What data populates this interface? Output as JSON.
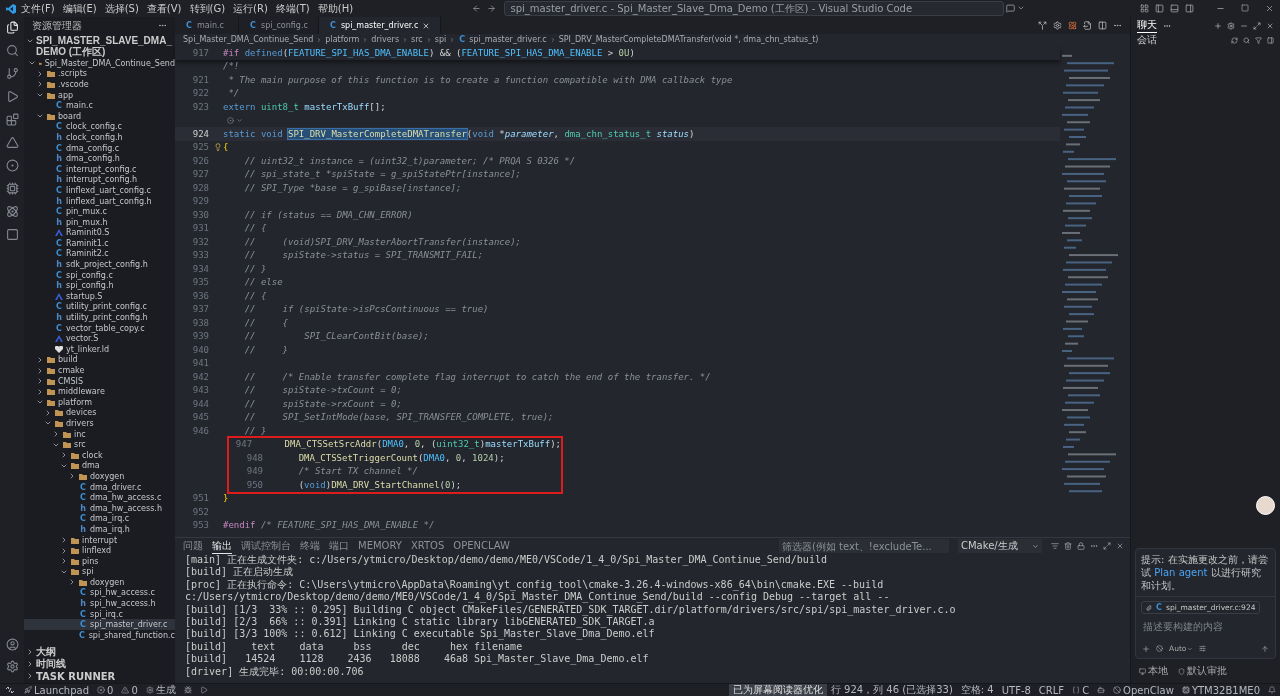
{
  "menu": [
    "文件(F)",
    "编辑(E)",
    "选择(S)",
    "查看(V)",
    "转到(G)",
    "运行(R)",
    "终端(T)",
    "帮助(H)"
  ],
  "title_search": "spi_master_driver.c - Spi_Master_Slave_Dma_Demo (工作区) - Visual Studio Code",
  "sidebar": {
    "title": "资源管理器",
    "workspace": "SPI_MASTER_SLAVE_DMA_DEMO (工作区)",
    "tree": [
      {
        "name": "Spi_Master_DMA_Continue_Send",
        "kind": "folder",
        "expanded": true,
        "selected": false,
        "children": [
          {
            "name": ".scripts",
            "kind": "folder",
            "expanded": false,
            "selected": false
          },
          {
            "name": ".vscode",
            "kind": "folder",
            "expanded": false,
            "selected": false
          },
          {
            "name": "app",
            "kind": "folder",
            "expanded": true,
            "selected": false,
            "children": [
              {
                "name": "main.c",
                "kind": "c",
                "glyph": "C",
                "selected": false
              }
            ]
          },
          {
            "name": "board",
            "kind": "folder",
            "expanded": true,
            "selected": false,
            "children": [
              {
                "name": "clock_config.c",
                "kind": "c",
                "glyph": "C",
                "selected": false
              },
              {
                "name": "clock_config.h",
                "kind": "h",
                "glyph": "h",
                "selected": false
              },
              {
                "name": "dma_config.c",
                "kind": "c",
                "glyph": "C",
                "selected": false
              },
              {
                "name": "dma_config.h",
                "kind": "h",
                "glyph": "h",
                "selected": false
              },
              {
                "name": "interrupt_config.c",
                "kind": "c",
                "glyph": "C",
                "selected": false
              },
              {
                "name": "interrupt_config.h",
                "kind": "h",
                "glyph": "h",
                "selected": false
              },
              {
                "name": "linflexd_uart_config.c",
                "kind": "c",
                "glyph": "C",
                "selected": false
              },
              {
                "name": "linflexd_uart_config.h",
                "kind": "h",
                "glyph": "h",
                "selected": false
              },
              {
                "name": "pin_mux.c",
                "kind": "c",
                "glyph": "C",
                "selected": false
              },
              {
                "name": "pin_mux.h",
                "kind": "h",
                "glyph": "h",
                "selected": false
              },
              {
                "name": "Raminit0.S",
                "kind": "asm",
                "selected": false
              },
              {
                "name": "Raminit1.c",
                "kind": "c",
                "glyph": "C",
                "selected": false
              },
              {
                "name": "Raminit2.c",
                "kind": "c",
                "glyph": "C",
                "selected": false
              },
              {
                "name": "sdk_project_config.h",
                "kind": "h",
                "glyph": "h",
                "selected": false
              },
              {
                "name": "spi_config.c",
                "kind": "c",
                "glyph": "C",
                "selected": false
              },
              {
                "name": "spi_config.h",
                "kind": "h",
                "glyph": "h",
                "selected": false
              },
              {
                "name": "startup.S",
                "kind": "asm",
                "selected": false
              },
              {
                "name": "utility_print_config.c",
                "kind": "c",
                "glyph": "C",
                "selected": false
              },
              {
                "name": "utility_print_config.h",
                "kind": "h",
                "glyph": "h",
                "selected": false
              },
              {
                "name": "vector_table_copy.c",
                "kind": "c",
                "glyph": "C",
                "selected": false
              },
              {
                "name": "vector.S",
                "kind": "asm",
                "selected": false
              },
              {
                "name": "yt_linker.ld",
                "kind": "ld",
                "selected": false
              }
            ]
          },
          {
            "name": "build",
            "kind": "folder",
            "expanded": false,
            "selected": false
          },
          {
            "name": "cmake",
            "kind": "folder",
            "expanded": false,
            "selected": false
          },
          {
            "name": "CMSIS",
            "kind": "folder",
            "expanded": false,
            "selected": false
          },
          {
            "name": "middleware",
            "kind": "folder",
            "expanded": false,
            "selected": false
          },
          {
            "name": "platform",
            "kind": "folder",
            "expanded": true,
            "selected": false,
            "children": [
              {
                "name": "devices",
                "kind": "folder",
                "expanded": false,
                "selected": false
              },
              {
                "name": "drivers",
                "kind": "folder",
                "expanded": true,
                "selected": false,
                "children": [
                  {
                    "name": "inc",
                    "kind": "folder",
                    "expanded": false,
                    "selected": false
                  },
                  {
                    "name": "src",
                    "kind": "folder",
                    "expanded": true,
                    "selected": false,
                    "children": [
                      {
                        "name": "clock",
                        "kind": "folder",
                        "expanded": false,
                        "selected": false
                      },
                      {
                        "name": "dma",
                        "kind": "folder",
                        "expanded": true,
                        "selected": false,
                        "children": [
                          {
                            "name": "doxygen",
                            "kind": "folder",
                            "expanded": false,
                            "selected": false
                          },
                          {
                            "name": "dma_driver.c",
                            "kind": "c",
                            "glyph": "C",
                            "selected": false
                          },
                          {
                            "name": "dma_hw_access.c",
                            "kind": "c",
                            "glyph": "C",
                            "selected": false
                          },
                          {
                            "name": "dma_hw_access.h",
                            "kind": "h",
                            "glyph": "h",
                            "selected": false
                          },
                          {
                            "name": "dma_irq.c",
                            "kind": "c",
                            "glyph": "C",
                            "selected": false
                          },
                          {
                            "name": "dma_irq.h",
                            "kind": "h",
                            "glyph": "h",
                            "selected": false
                          }
                        ]
                      },
                      {
                        "name": "interrupt",
                        "kind": "folder",
                        "expanded": false,
                        "selected": false
                      },
                      {
                        "name": "linflexd",
                        "kind": "folder",
                        "expanded": false,
                        "selected": false
                      },
                      {
                        "name": "pins",
                        "kind": "folder",
                        "expanded": false,
                        "selected": false
                      },
                      {
                        "name": "spi",
                        "kind": "folder",
                        "expanded": true,
                        "selected": false,
                        "children": [
                          {
                            "name": "doxygen",
                            "kind": "folder",
                            "expanded": false,
                            "selected": false
                          },
                          {
                            "name": "spi_hw_access.c",
                            "kind": "c",
                            "glyph": "C",
                            "selected": false
                          },
                          {
                            "name": "spi_hw_access.h",
                            "kind": "h",
                            "glyph": "h",
                            "selected": false
                          },
                          {
                            "name": "spi_irq.c",
                            "kind": "c",
                            "glyph": "C",
                            "selected": false
                          },
                          {
                            "name": "spi_master_driver.c",
                            "kind": "c",
                            "glyph": "C",
                            "selected": true
                          },
                          {
                            "name": "spi_shared_function.c",
                            "kind": "c",
                            "glyph": "C",
                            "selected": false
                          }
                        ]
                      }
                    ]
                  }
                ]
              }
            ]
          }
        ]
      }
    ],
    "sections": [
      "大纲",
      "时间线",
      "TASK RUNNER"
    ]
  },
  "tabs": [
    {
      "glyph": "C",
      "label": "main.c",
      "selected": false
    },
    {
      "glyph": "C",
      "label": "spi_config.c",
      "selected": false
    },
    {
      "glyph": "C",
      "label": "spi_master_driver.c",
      "selected": true
    }
  ],
  "breadcrumb": [
    "Spi_Master_DMA_Continue_Send",
    "platform",
    "drivers",
    "src",
    "spi"
  ],
  "breadcrumb_file": {
    "glyph": "C",
    "label": "spi_master_driver.c"
  },
  "breadcrumb_symbol": "SPI_DRV_MasterCompleteDMATransfer(void *, dma_chn_status_t)",
  "code": {
    "sticky": {
      "number": "917",
      "tokens": [
        {
          "kind": "directive",
          "text": "#if "
        },
        {
          "kind": "kw",
          "text": "defined"
        },
        {
          "kind": "plain",
          "text": "("
        },
        {
          "kind": "macro",
          "text": "FEATURE_SPI_HAS_DMA_ENABLE"
        },
        {
          "kind": "plain",
          "text": ") && ("
        },
        {
          "kind": "macro",
          "text": "FEATURE_SPI_HAS_DMA_ENABLE"
        },
        {
          "kind": "plain",
          "text": " > "
        },
        {
          "kind": "num",
          "text": "0U"
        },
        {
          "kind": "plain",
          "text": ")"
        }
      ]
    },
    "lines": [
      {
        "boxed": false,
        "tokens": [
          {
            "kind": "comment",
            "text": "/*!"
          }
        ]
      },
      {
        "number": "921",
        "boxed": false,
        "tokens": [
          {
            "kind": "comment",
            "text": " * The main purpose of this function is to create a function compatible with DMA callback type"
          }
        ]
      },
      {
        "number": "922",
        "boxed": false,
        "tokens": [
          {
            "kind": "comment",
            "text": " */"
          }
        ]
      },
      {
        "number": "923",
        "boxed": false,
        "tokens": [
          {
            "kind": "kw",
            "text": "extern "
          },
          {
            "kind": "type",
            "text": "uint8_t"
          },
          {
            "kind": "var",
            "text": " masterTxBuff"
          },
          {
            "kind": "plain",
            "text": "[];"
          }
        ]
      },
      {
        "kind": "lens",
        "boxed": false
      },
      {
        "number": "924",
        "current": true,
        "boxed": false,
        "tokens": [
          {
            "kind": "kw",
            "text": "static void "
          },
          {
            "kind": "match",
            "text": "SPI_DRV_MasterCompleteDMATransfer"
          },
          {
            "kind": "plain",
            "text": "("
          },
          {
            "kind": "kw",
            "text": "void "
          },
          {
            "kind": "plain",
            "text": "*"
          },
          {
            "kind": "param",
            "text": "parameter"
          },
          {
            "kind": "plain",
            "text": ", "
          },
          {
            "kind": "type",
            "text": "dma_chn_status_t"
          },
          {
            "kind": "param",
            "text": " status"
          },
          {
            "kind": "plain",
            "text": ")"
          }
        ]
      },
      {
        "number": "925",
        "bulb": true,
        "boxed": false,
        "tokens": [
          {
            "kind": "brace",
            "text": "{"
          }
        ]
      },
      {
        "number": "926",
        "boxed": false,
        "tokens": [
          {
            "kind": "comment",
            "text": "    // uint32_t instance = (uint32_t)parameter; /* PRQA S 0326 */"
          }
        ]
      },
      {
        "number": "927",
        "boxed": false,
        "tokens": [
          {
            "kind": "comment",
            "text": "    // spi_state_t *spiState = g_spiStatePtr[instance];"
          }
        ]
      },
      {
        "number": "928",
        "boxed": false,
        "tokens": [
          {
            "kind": "comment",
            "text": "    // SPI_Type *base = g_spiBase[instance];"
          }
        ]
      },
      {
        "number": "929",
        "boxed": false
      },
      {
        "number": "930",
        "boxed": false,
        "tokens": [
          {
            "kind": "comment",
            "text": "    // if (status == DMA_CHN_ERROR)"
          }
        ]
      },
      {
        "number": "931",
        "boxed": false,
        "tokens": [
          {
            "kind": "comment",
            "text": "    // {"
          }
        ]
      },
      {
        "number": "932",
        "boxed": false,
        "tokens": [
          {
            "kind": "comment",
            "text": "    //     (void)SPI_DRV_MasterAbortTransfer(instance);"
          }
        ]
      },
      {
        "number": "933",
        "boxed": false,
        "tokens": [
          {
            "kind": "comment",
            "text": "    //     spiState->status = SPI_TRANSMIT_FAIL;"
          }
        ]
      },
      {
        "number": "934",
        "boxed": false,
        "tokens": [
          {
            "kind": "comment",
            "text": "    // }"
          }
        ]
      },
      {
        "number": "935",
        "boxed": false,
        "tokens": [
          {
            "kind": "comment",
            "text": "    // else"
          }
        ]
      },
      {
        "number": "936",
        "boxed": false,
        "tokens": [
          {
            "kind": "comment",
            "text": "    // {"
          }
        ]
      },
      {
        "number": "937",
        "boxed": false,
        "tokens": [
          {
            "kind": "comment",
            "text": "    //     if (spiState->isPcsContinuous == true)"
          }
        ]
      },
      {
        "number": "938",
        "boxed": false,
        "tokens": [
          {
            "kind": "comment",
            "text": "    //     {"
          }
        ]
      },
      {
        "number": "939",
        "boxed": false,
        "tokens": [
          {
            "kind": "comment",
            "text": "    //         SPI_CLearContBit(base);"
          }
        ]
      },
      {
        "number": "940",
        "boxed": false,
        "tokens": [
          {
            "kind": "comment",
            "text": "    //     }"
          }
        ]
      },
      {
        "number": "941",
        "boxed": false
      },
      {
        "number": "942",
        "boxed": false,
        "tokens": [
          {
            "kind": "comment",
            "text": "    //     /* Enable transfer complete flag interrupt to catch the end of the transfer. */"
          }
        ]
      },
      {
        "number": "943",
        "boxed": false,
        "tokens": [
          {
            "kind": "comment",
            "text": "    //     spiState->txCount = 0;"
          }
        ]
      },
      {
        "number": "944",
        "boxed": false,
        "tokens": [
          {
            "kind": "comment",
            "text": "    //     spiState->rxCount = 0;"
          }
        ]
      },
      {
        "number": "945",
        "boxed": false,
        "tokens": [
          {
            "kind": "comment",
            "text": "    //     SPI_SetIntMode(base, SPI_TRANSFER_COMPLETE, true);"
          }
        ]
      },
      {
        "number": "946",
        "boxed": false,
        "tokens": [
          {
            "kind": "comment",
            "text": "    // }"
          }
        ]
      },
      {
        "number": "947",
        "boxed": true,
        "tokens": [
          {
            "kind": "fn",
            "text": "    DMA_CTSSetSrcAddr"
          },
          {
            "kind": "plain",
            "text": "("
          },
          {
            "kind": "macro",
            "text": "DMA0"
          },
          {
            "kind": "plain",
            "text": ", "
          },
          {
            "kind": "num",
            "text": "0"
          },
          {
            "kind": "plain",
            "text": ", ("
          },
          {
            "kind": "type",
            "text": "uint32_t"
          },
          {
            "kind": "plain",
            "text": ")"
          },
          {
            "kind": "var",
            "text": "masterTxBuff"
          },
          {
            "kind": "plain",
            "text": ");"
          }
        ]
      },
      {
        "number": "948",
        "boxed": true,
        "tokens": [
          {
            "kind": "fn",
            "text": "    DMA_CTSSetTriggerCount"
          },
          {
            "kind": "plain",
            "text": "("
          },
          {
            "kind": "macro",
            "text": "DMA0"
          },
          {
            "kind": "plain",
            "text": ", "
          },
          {
            "kind": "num",
            "text": "0"
          },
          {
            "kind": "plain",
            "text": ", "
          },
          {
            "kind": "num",
            "text": "1024"
          },
          {
            "kind": "plain",
            "text": ");"
          }
        ]
      },
      {
        "number": "949",
        "boxed": true,
        "tokens": [
          {
            "kind": "comment",
            "text": "    /* Start TX channel */"
          }
        ]
      },
      {
        "number": "950",
        "boxed": true,
        "tokens": [
          {
            "kind": "plain",
            "text": "    ("
          },
          {
            "kind": "kw",
            "text": "void"
          },
          {
            "kind": "plain",
            "text": ")"
          },
          {
            "kind": "fn",
            "text": "DMA_DRV_StartChannel"
          },
          {
            "kind": "plain",
            "text": "("
          },
          {
            "kind": "num",
            "text": "0"
          },
          {
            "kind": "plain",
            "text": ");"
          }
        ]
      },
      {
        "number": "951",
        "boxed": false,
        "tokens": [
          {
            "kind": "brace",
            "text": "}"
          }
        ]
      },
      {
        "number": "952",
        "boxed": false
      },
      {
        "number": "953",
        "boxed": false,
        "tokens": [
          {
            "kind": "directive",
            "text": "#endif "
          },
          {
            "kind": "comment",
            "text": "/* FEATURE_SPI_HAS_DMA_ENABLE */"
          }
        ]
      }
    ]
  },
  "panel": {
    "tabs": [
      {
        "label": "问题",
        "selected": false
      },
      {
        "label": "输出",
        "selected": true
      },
      {
        "label": "调试控制台",
        "selected": false
      },
      {
        "label": "终端",
        "selected": false
      },
      {
        "label": "端口",
        "selected": false
      },
      {
        "label": "MEMORY",
        "selected": false
      },
      {
        "label": "XRTOS",
        "selected": false
      },
      {
        "label": "OPENCLAW",
        "selected": false
      }
    ],
    "filter_placeholder": "筛选器(例如 text、!excludeTe...",
    "channel": "CMake/生成",
    "output": [
      "[main] 正在生成文件夹: c:/Users/ytmicro/Desktop/demo/demo/ME0/VSCode/1_4_0/Spi_Master_DMA_Continue_Send/build",
      "[build] 正在启动生成",
      "[proc] 正在执行命令: C:\\Users\\ytmicro\\AppData\\Roaming\\yt_config_tool\\cmake-3.26.4-windows-x86_64\\bin\\cmake.EXE --build",
      "c:/Users/ytmicro/Desktop/demo/demo/ME0/VSCode/1_4_0/Spi_Master_DMA_Continue_Send/build --config Debug --target all --",
      "[build] [1/3  33% :: 0.295] Building C object CMakeFiles/GENERATED_SDK_TARGET.dir/platform/drivers/src/spi/spi_master_driver.c.o",
      "[build] [2/3  66% :: 0.391] Linking C static library libGENERATED_SDK_TARGET.a",
      "[build] [3/3 100% :: 0.612] Linking C executable Spi_Master_Slave_Dma_Demo.elf",
      "[build]    text    data     bss     dec     hex filename",
      "[build]   14524    1128    2436   18088    46a8 Spi_Master_Slave_Dma_Demo.elf",
      "[driver] 生成完毕: 00:00:00.706"
    ]
  },
  "chat": {
    "tabs": [
      {
        "label": "聊天",
        "selected": true
      }
    ],
    "subtitle": "会话",
    "tip": "提示: 在实施更改之前，请尝试 ",
    "tip_link": "Plan agent",
    "tip_end": " 以进行研究和计划。",
    "context_chip": {
      "glyph": "C",
      "label": "spi_master_driver.c:924"
    },
    "input_placeholder": "描述要构建的内容",
    "mode": "Auto",
    "location": "本地",
    "approval": "默认审批"
  },
  "status": {
    "left": [
      {
        "kind": "launchpad",
        "text": "Launchpad"
      },
      {
        "kind": "error",
        "text": "0"
      },
      {
        "kind": "warning",
        "text": "0"
      },
      {
        "kind": "gear",
        "text": "生成"
      },
      {
        "kind": "bug"
      },
      {
        "kind": "play"
      }
    ],
    "right": [
      {
        "kind": "text",
        "text": "已为屏幕阅读器优化",
        "highlighted": true
      },
      {
        "kind": "text",
        "text": "行 924，列 46 (已选择33)",
        "highlighted": false
      },
      {
        "kind": "text",
        "text": "空格: 4",
        "highlighted": false
      },
      {
        "kind": "text",
        "text": "UTF-8",
        "highlighted": false
      },
      {
        "kind": "text",
        "text": "CRLF",
        "highlighted": false
      },
      {
        "kind": "braces",
        "text": "C",
        "highlighted": false
      },
      {
        "kind": "robot",
        "highlighted": false
      },
      {
        "kind": "blocked",
        "text": "OpenClaw",
        "highlighted": false
      },
      {
        "kind": "chip",
        "text": "YTM32B1ME0",
        "highlighted": false
      },
      {
        "kind": "bell",
        "highlighted": false
      }
    ]
  }
}
